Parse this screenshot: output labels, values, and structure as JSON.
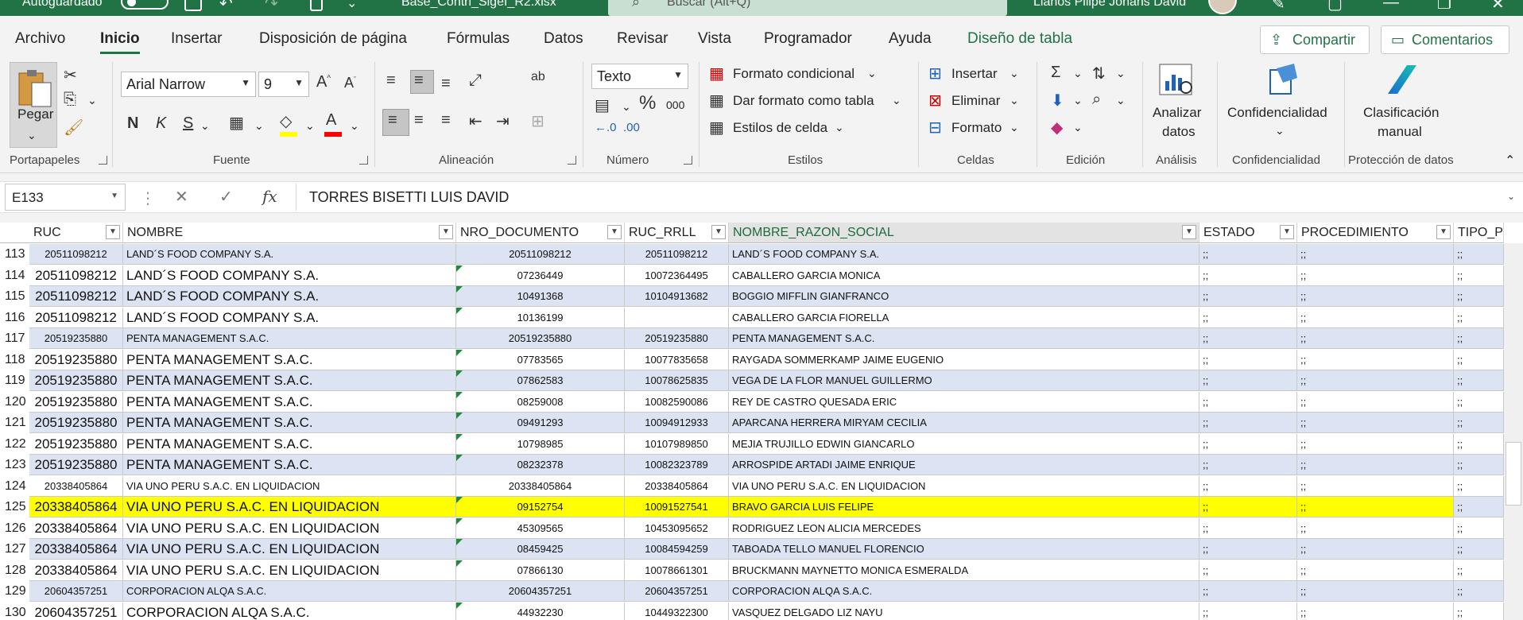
{
  "titlebar": {
    "autosave_label": "Autoguardado",
    "filename": "Base_Contri_Sigef_R2.xlsx",
    "search_placeholder": "Buscar (Alt+Q)",
    "user_name": "Llanos Pilipe Johans David"
  },
  "tabs": [
    "Archivo",
    "Inicio",
    "Insertar",
    "Disposición de página",
    "Fórmulas",
    "Datos",
    "Revisar",
    "Vista",
    "Programador",
    "Ayuda",
    "Diseño de tabla"
  ],
  "actions": {
    "share": "Compartir",
    "comments": "Comentarios"
  },
  "ribbon": {
    "portapapeles": {
      "label": "Portapapeles",
      "paste": "Pegar"
    },
    "fuente": {
      "label": "Fuente",
      "font_name": "Arial Narrow",
      "font_size": "9",
      "bold": "N",
      "italic": "K",
      "underline": "S",
      "highlight_color": "#ffff00",
      "font_color": "#ff0000"
    },
    "alineacion": {
      "label": "Alineación"
    },
    "numero": {
      "label": "Número",
      "format": "Texto",
      "percent": "%",
      "thousands": "000"
    },
    "estilos": {
      "label": "Estilos",
      "conditional": "Formato condicional",
      "as_table": "Dar formato como tabla",
      "cell_styles": "Estilos de celda"
    },
    "celdas": {
      "label": "Celdas",
      "insert": "Insertar",
      "delete": "Eliminar",
      "format": "Formato"
    },
    "edicion": {
      "label": "Edición"
    },
    "analisis": {
      "label": "Análisis",
      "analyze_line1": "Analizar",
      "analyze_line2": "datos"
    },
    "confidencialidad": {
      "label": "Confidencialidad",
      "button": "Confidencialidad"
    },
    "proteccion": {
      "label": "Protección de datos",
      "line1": "Clasificación",
      "line2": "manual"
    }
  },
  "formula_bar": {
    "name_box": "E133",
    "formula": "TORRES BISETTI LUIS DAVID"
  },
  "columns": [
    "RUC",
    "NOMBRE",
    "NRO_DOCUMENTO",
    "RUC_RRLL",
    "NOMBRE_RAZON_SOCIAL",
    "ESTADO",
    "PROCEDIMIENTO",
    "TIPO_P"
  ],
  "rows": [
    {
      "n": "113",
      "ruc": "20511098212",
      "nombre": "LAND´S FOOD COMPANY S.A.",
      "doc": "20511098212",
      "ruc_rrll": "20511098212",
      "razon": "LAND´S FOOD COMPANY S.A.",
      "estado": ";;",
      "proc": ";;",
      "tipo": ";;",
      "big": false,
      "hl": false
    },
    {
      "n": "114",
      "ruc": "20511098212",
      "nombre": "LAND´S FOOD COMPANY S.A.",
      "doc": "07236449",
      "ruc_rrll": "10072364495",
      "razon": "CABALLERO GARCIA MONICA",
      "estado": ";;",
      "proc": ";;",
      "tipo": ";;",
      "big": true,
      "hl": false
    },
    {
      "n": "115",
      "ruc": "20511098212",
      "nombre": "LAND´S FOOD COMPANY S.A.",
      "doc": "10491368",
      "ruc_rrll": "10104913682",
      "razon": "BOGGIO MIFFLIN GIANFRANCO",
      "estado": ";;",
      "proc": ";;",
      "tipo": ";;",
      "big": true,
      "hl": false
    },
    {
      "n": "116",
      "ruc": "20511098212",
      "nombre": "LAND´S FOOD COMPANY S.A.",
      "doc": "10136199",
      "ruc_rrll": "",
      "razon": "CABALLERO GARCIA FIORELLA",
      "estado": ";;",
      "proc": ";;",
      "tipo": ";;",
      "big": true,
      "hl": false
    },
    {
      "n": "117",
      "ruc": "20519235880",
      "nombre": "PENTA MANAGEMENT S.A.C.",
      "doc": "20519235880",
      "ruc_rrll": "20519235880",
      "razon": "PENTA MANAGEMENT S.A.C.",
      "estado": ";;",
      "proc": ";;",
      "tipo": ";;",
      "big": false,
      "hl": false
    },
    {
      "n": "118",
      "ruc": "20519235880",
      "nombre": "PENTA MANAGEMENT S.A.C.",
      "doc": "07783565",
      "ruc_rrll": "10077835658",
      "razon": "RAYGADA SOMMERKAMP JAIME EUGENIO",
      "estado": ";;",
      "proc": ";;",
      "tipo": ";;",
      "big": true,
      "hl": false
    },
    {
      "n": "119",
      "ruc": "20519235880",
      "nombre": "PENTA MANAGEMENT S.A.C.",
      "doc": "07862583",
      "ruc_rrll": "10078625835",
      "razon": "VEGA DE LA FLOR MANUEL GUILLERMO",
      "estado": ";;",
      "proc": ";;",
      "tipo": ";;",
      "big": true,
      "hl": false
    },
    {
      "n": "120",
      "ruc": "20519235880",
      "nombre": "PENTA MANAGEMENT S.A.C.",
      "doc": "08259008",
      "ruc_rrll": "10082590086",
      "razon": "REY DE CASTRO QUESADA ERIC",
      "estado": ";;",
      "proc": ";;",
      "tipo": ";;",
      "big": true,
      "hl": false
    },
    {
      "n": "121",
      "ruc": "20519235880",
      "nombre": "PENTA MANAGEMENT S.A.C.",
      "doc": "09491293",
      "ruc_rrll": "10094912933",
      "razon": "APARCANA HERRERA MIRYAM CECILIA",
      "estado": ";;",
      "proc": ";;",
      "tipo": ";;",
      "big": true,
      "hl": false
    },
    {
      "n": "122",
      "ruc": "20519235880",
      "nombre": "PENTA MANAGEMENT S.A.C.",
      "doc": "10798985",
      "ruc_rrll": "10107989850",
      "razon": "MEJIA TRUJILLO EDWIN GIANCARLO",
      "estado": ";;",
      "proc": ";;",
      "tipo": ";;",
      "big": true,
      "hl": false
    },
    {
      "n": "123",
      "ruc": "20519235880",
      "nombre": "PENTA MANAGEMENT S.A.C.",
      "doc": "08232378",
      "ruc_rrll": "10082323789",
      "razon": "ARROSPIDE ARTADI JAIME ENRIQUE",
      "estado": ";;",
      "proc": ";;",
      "tipo": ";;",
      "big": true,
      "hl": false
    },
    {
      "n": "124",
      "ruc": "20338405864",
      "nombre": "VIA UNO PERU S.A.C. EN LIQUIDACION",
      "doc": "20338405864",
      "ruc_rrll": "20338405864",
      "razon": "VIA UNO PERU S.A.C. EN LIQUIDACION",
      "estado": ";;",
      "proc": ";;",
      "tipo": ";;",
      "big": false,
      "hl": false
    },
    {
      "n": "125",
      "ruc": "20338405864",
      "nombre": "VIA UNO PERU S.A.C. EN LIQUIDACION",
      "doc": "09152754",
      "ruc_rrll": "10091527541",
      "razon": "BRAVO GARCIA LUIS FELIPE",
      "estado": ";;",
      "proc": ";;",
      "tipo": ";;",
      "big": true,
      "hl": true
    },
    {
      "n": "126",
      "ruc": "20338405864",
      "nombre": "VIA UNO PERU S.A.C. EN LIQUIDACION",
      "doc": "45309565",
      "ruc_rrll": "10453095652",
      "razon": "RODRIGUEZ LEON ALICIA MERCEDES",
      "estado": ";;",
      "proc": ";;",
      "tipo": ";;",
      "big": true,
      "hl": false
    },
    {
      "n": "127",
      "ruc": "20338405864",
      "nombre": "VIA UNO PERU S.A.C. EN LIQUIDACION",
      "doc": "08459425",
      "ruc_rrll": "10084594259",
      "razon": "TABOADA TELLO MANUEL FLORENCIO",
      "estado": ";;",
      "proc": ";;",
      "tipo": ";;",
      "big": true,
      "hl": false
    },
    {
      "n": "128",
      "ruc": "20338405864",
      "nombre": "VIA UNO PERU S.A.C. EN LIQUIDACION",
      "doc": "07866130",
      "ruc_rrll": "10078661301",
      "razon": "BRUCKMANN MAYNETTO MONICA ESMERALDA",
      "estado": ";;",
      "proc": ";;",
      "tipo": ";;",
      "big": true,
      "hl": false
    },
    {
      "n": "129",
      "ruc": "20604357251",
      "nombre": "CORPORACION ALQA S.A.C.",
      "doc": "20604357251",
      "ruc_rrll": "20604357251",
      "razon": "CORPORACION ALQA S.A.C.",
      "estado": ";;",
      "proc": ";;",
      "tipo": ";;",
      "big": false,
      "hl": false
    },
    {
      "n": "130",
      "ruc": "20604357251",
      "nombre": "CORPORACION ALQA S.A.C.",
      "doc": "44932230",
      "ruc_rrll": "10449322300",
      "razon": "VASQUEZ DELGADO LIZ NAYU",
      "estado": ";;",
      "proc": ";;",
      "tipo": ";;",
      "big": true,
      "hl": false
    }
  ],
  "colors": {
    "excel_green": "#217346",
    "band": "#dce3f2",
    "highlight": "#ffff00"
  }
}
